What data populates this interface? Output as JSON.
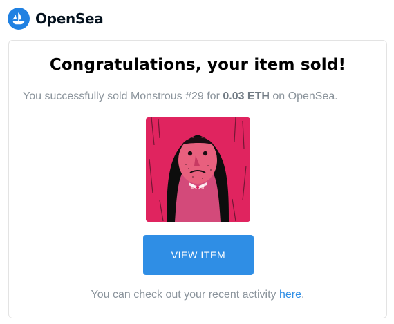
{
  "brand": {
    "name": "OpenSea",
    "accent": "#2081e2"
  },
  "card": {
    "title": "Congratulations, your item sold!",
    "subtitle_prefix": "You successfully sold Monstrous #29 for ",
    "price": "0.03 ETH",
    "subtitle_suffix": " on OpenSea.",
    "image_icon": "nft-portrait-image",
    "button_label": "VIEW ITEM",
    "button_color": "#2f8ee5",
    "footer_prefix": "You can check out your recent activity ",
    "footer_link": "here",
    "footer_suffix": "."
  }
}
